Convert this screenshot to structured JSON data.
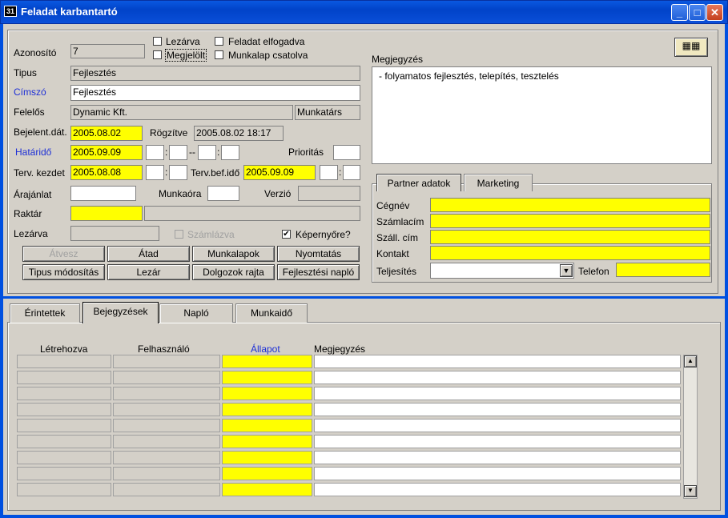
{
  "window": {
    "title": "Feladat karbantartó",
    "app_icon": "app-icon",
    "controls": [
      "minimize-icon",
      "maximize-icon",
      "close-icon"
    ]
  },
  "form": {
    "azonosito_label": "Azonosító",
    "azonosito_value": "7",
    "lezarva_cb": "Lezárva",
    "megjelolt_cb": "Megjelölt",
    "elfogadva_cb": "Feladat elfogadva",
    "munkalap_cb": "Munkalap csatolva",
    "tipus_label": "Tipus",
    "tipus_value": "Fejlesztés",
    "cimszo_label": "Címszó",
    "cimszo_value": "Fejlesztés",
    "felelos_label": "Felelős",
    "felelos_value": "Dynamic Kft.",
    "munkatars_value": "Munkatárs",
    "bejelent_label": "Bejelent.dát.",
    "bejelent_value": "2005.08.02",
    "rogzitve_label": "Rögzítve",
    "rogzitve_value": "2005.08.02 18:17",
    "hatarido_label": "Határidő",
    "hatarido_value": "2005.09.09",
    "dash": "--",
    "colon": ":",
    "prioritas_label": "Prioritás",
    "terv_kezdet_label": "Terv. kezdet",
    "terv_kezdet_value": "2005.08.08",
    "terv_bef_label": "Terv.bef.idő",
    "terv_bef_value": "2005.09.09",
    "arajanlat_label": "Árajánlat",
    "munkaora_label": "Munkaóra",
    "verzio_label": "Verzió",
    "raktar_label": "Raktár",
    "lezarva_label": "Lezárva",
    "szamlazva_cb": "Számlázva",
    "kepernyore_cb": "Képernyőre?"
  },
  "buttons": {
    "atvesz": "Átvesz",
    "atad": "Átad",
    "munkalapok": "Munkalapok",
    "nyomtatas": "Nyomtatás",
    "tipus_mod": "Tipus módosítás",
    "lezar": "Lezár",
    "dolgozok": "Dolgozok rajta",
    "fejl_naplo": "Fejlesztési napló"
  },
  "notes": {
    "label": "Megjegyzés",
    "text": "- folyamatos fejlesztés, telepítés, tesztelés"
  },
  "partner": {
    "tabs": [
      "Partner adatok",
      "Marketing"
    ],
    "cegnev": "Cégnév",
    "szamlacim": "Számlacím",
    "szall_cim": "Száll. cím",
    "kontakt": "Kontakt",
    "teljesites": "Teljesítés",
    "telefon": "Telefon"
  },
  "bottom": {
    "tabs": [
      "Érintettek",
      "Bejegyzések",
      "Napló",
      "Munkaidő"
    ],
    "columns": [
      "Létrehozva",
      "Felhasználó",
      "Állapot",
      "Megjegyzés"
    ]
  },
  "colors": {
    "accent": "#0a58e0",
    "required": "#ffff00",
    "link_label": "#1d2fd6"
  }
}
